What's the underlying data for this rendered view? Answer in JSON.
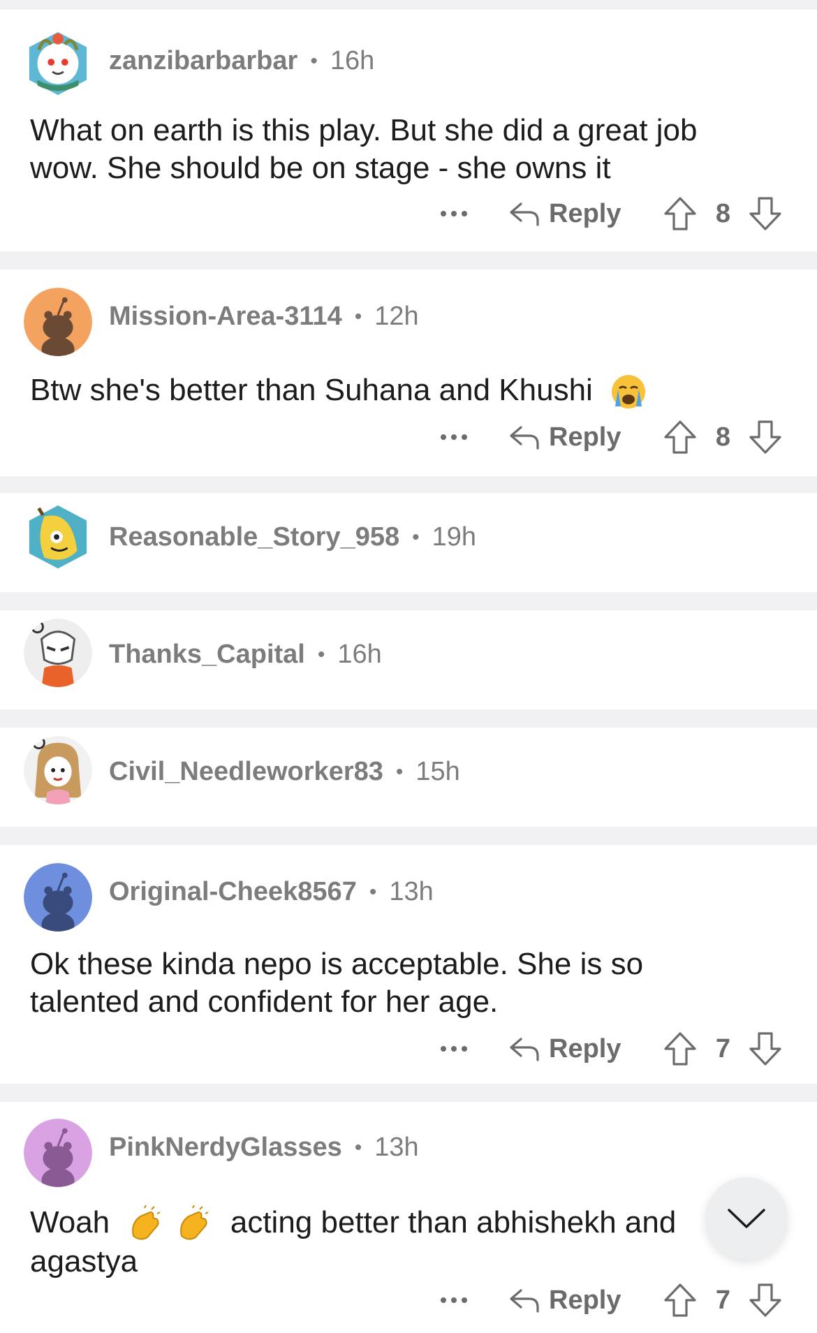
{
  "comments": [
    {
      "user": "zanzibarbarbar",
      "time": "16h",
      "lines": [
        "What on earth is this play. But she did a great job",
        "wow. She should be on stage - she owns it"
      ],
      "reply_label": "Reply",
      "score": "8"
    },
    {
      "user": "Mission-Area-3114",
      "time": "12h",
      "lines": [
        "Btw she's better than Suhana and Khushi"
      ],
      "emoji": "crying-face",
      "reply_label": "Reply",
      "score": "8"
    },
    {
      "user": "Reasonable_Story_958",
      "time": "19h"
    },
    {
      "user": "Thanks_Capital",
      "time": "16h"
    },
    {
      "user": "Civil_Needleworker83",
      "time": "15h"
    },
    {
      "user": "Original-Cheek8567",
      "time": "13h",
      "lines": [
        "Ok these kinda nepo is acceptable. She is so",
        "talented and confident for her age."
      ],
      "reply_label": "Reply",
      "score": "7"
    },
    {
      "user": "PinkNerdyGlasses",
      "time": "13h",
      "line1_start": "Woah",
      "line1_end": "acting better than abhishekh and",
      "line2": "agastya",
      "emoji": "clapping-hands",
      "reply_label": "Reply",
      "score": "7"
    }
  ],
  "separator": "•",
  "icons": {
    "more": "more-icon",
    "reply": "reply-arrow-icon",
    "upvote": "upvote-arrow-icon",
    "downvote": "downvote-arrow-icon",
    "scroll": "chevron-down-icon"
  }
}
